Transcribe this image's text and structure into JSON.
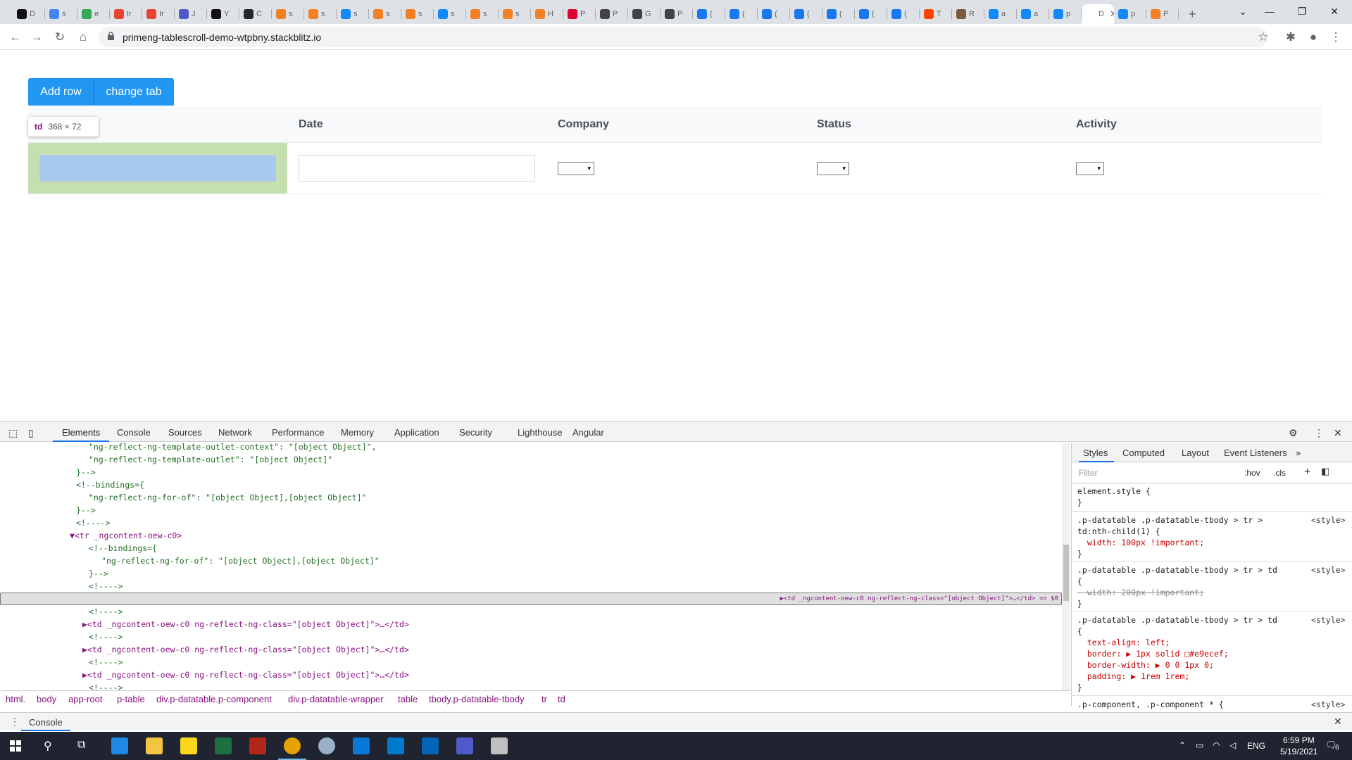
{
  "browser": {
    "tabs": [
      {
        "label": "D",
        "color": "#111111"
      },
      {
        "label": "s",
        "color": "#4285f4"
      },
      {
        "label": "e",
        "color": "#34a853"
      },
      {
        "label": "Ir",
        "color": "#ea4335"
      },
      {
        "label": "Ir",
        "color": "#ea4335"
      },
      {
        "label": "J",
        "color": "#5059c9"
      },
      {
        "label": "Y",
        "color": "#111111"
      },
      {
        "label": "C",
        "color": "#24292e"
      },
      {
        "label": "s",
        "color": "#f48024"
      },
      {
        "label": "s",
        "color": "#f48024"
      },
      {
        "label": "s",
        "color": "#1389fd"
      },
      {
        "label": "s",
        "color": "#f48024"
      },
      {
        "label": "s",
        "color": "#f48024"
      },
      {
        "label": "s",
        "color": "#1389fd"
      },
      {
        "label": "s",
        "color": "#f48024"
      },
      {
        "label": "s",
        "color": "#f48024"
      },
      {
        "label": "H",
        "color": "#f48024"
      },
      {
        "label": "P",
        "color": "#dd0031"
      },
      {
        "label": "P",
        "color": "#444444"
      },
      {
        "label": "G",
        "color": "#444444"
      },
      {
        "label": "P",
        "color": "#444444"
      },
      {
        "label": "(",
        "color": "#1877f2"
      },
      {
        "label": "(",
        "color": "#1877f2"
      },
      {
        "label": "(",
        "color": "#1877f2"
      },
      {
        "label": "(",
        "color": "#1877f2"
      },
      {
        "label": "(",
        "color": "#1877f2"
      },
      {
        "label": "(",
        "color": "#1877f2"
      },
      {
        "label": "(",
        "color": "#1877f2"
      },
      {
        "label": "T",
        "color": "#ff4500"
      },
      {
        "label": "R",
        "color": "#7a5c3b"
      },
      {
        "label": "a",
        "color": "#1389fd"
      },
      {
        "label": "a",
        "color": "#1389fd"
      },
      {
        "label": "p",
        "color": "#1389fd"
      },
      {
        "label": "D",
        "color": "#ffffff",
        "active": true
      },
      {
        "label": "p",
        "color": "#1389fd"
      },
      {
        "label": "P",
        "color": "#f48024"
      }
    ],
    "new_tab": "+",
    "url": "primeng-tablescroll-demo-wtpbny.stackblitz.io"
  },
  "page": {
    "buttons": {
      "add_row": "Add row",
      "change_tab": "change tab"
    },
    "columns": [
      "Date",
      "Company",
      "Status",
      "Activity"
    ],
    "select_arrow": "▾",
    "tooltip": {
      "tag": "td",
      "size": "368 × 72"
    },
    "colors": {
      "primary": "#2196f3",
      "highlight": "#c6dfb0",
      "input_highlight": "#a8c9ee"
    }
  },
  "devtools": {
    "tabs": [
      "Elements",
      "Console",
      "Sources",
      "Network",
      "Performance",
      "Memory",
      "Application",
      "Security",
      "Lighthouse",
      "Angular"
    ],
    "active_tab": "Elements",
    "dom_lines": [
      {
        "indent": 14,
        "text": "\"ng-reflect-ng-template-outlet-context\": \"[object Object]\",",
        "cls": "c-cm"
      },
      {
        "indent": 14,
        "text": "\"ng-reflect-ng-template-outlet\": \"[object Object]\"",
        "cls": "c-cm"
      },
      {
        "indent": 12,
        "text": "}-->",
        "cls": "c-cm"
      },
      {
        "indent": 12,
        "text": "<!--bindings={",
        "cls": "c-cm"
      },
      {
        "indent": 14,
        "text": "\"ng-reflect-ng-for-of\": \"[object Object],[object Object]\"",
        "cls": "c-cm"
      },
      {
        "indent": 12,
        "text": "}-->",
        "cls": "c-cm"
      },
      {
        "indent": 12,
        "text": "<!---->",
        "cls": "c-cm"
      },
      {
        "indent": 11,
        "text": "▼<tr _ngcontent-oew-c0>",
        "cls": "c-tag"
      },
      {
        "indent": 14,
        "text": "<!--bindings={",
        "cls": "c-cm"
      },
      {
        "indent": 16,
        "text": "\"ng-reflect-ng-for-of\": \"[object Object],[object Object]\"",
        "cls": "c-cm"
      },
      {
        "indent": 14,
        "text": "}-->",
        "cls": "c-cm"
      },
      {
        "indent": 14,
        "text": "<!---->",
        "cls": "c-cm"
      },
      {
        "indent": 13,
        "text": "▶<td _ngcontent-oew-c0 ng-reflect-ng-class=\"[object Object]\">…</td> == $0",
        "cls": "c-tag",
        "selected": true
      },
      {
        "indent": 14,
        "text": "<!---->",
        "cls": "c-cm"
      },
      {
        "indent": 13,
        "text": "▶<td _ngcontent-oew-c0 ng-reflect-ng-class=\"[object Object]\">…</td>",
        "cls": "c-tag"
      },
      {
        "indent": 14,
        "text": "<!---->",
        "cls": "c-cm"
      },
      {
        "indent": 13,
        "text": "▶<td _ngcontent-oew-c0 ng-reflect-ng-class=\"[object Object]\">…</td>",
        "cls": "c-tag"
      },
      {
        "indent": 14,
        "text": "<!---->",
        "cls": "c-cm"
      },
      {
        "indent": 13,
        "text": "▶<td _ngcontent-oew-c0 ng-reflect-ng-class=\"[object Object]\">…</td>",
        "cls": "c-tag"
      },
      {
        "indent": 14,
        "text": "<!---->",
        "cls": "c-cm"
      }
    ],
    "breadcrumbs": [
      "html.",
      "body",
      "app-root",
      "p-table",
      "div.p-datatable.p-component",
      "div.p-datatable-wrapper",
      "table",
      "tbody.p-datatable-tbody",
      "tr",
      "td"
    ],
    "styles_tabs": [
      "Styles",
      "Computed",
      "Layout",
      "Event Listeners",
      "»"
    ],
    "filter_placeholder": "Filter",
    "hov": ":hov",
    "cls": ".cls",
    "style_lines": [
      {
        "text": "element.style {",
        "kind": "sel-r"
      },
      {
        "text": "}",
        "kind": "sel-r"
      },
      {
        "text": ".p-datatable .p-datatable-tbody > tr >",
        "kind": "sel-r",
        "src": "<style>"
      },
      {
        "text": "td:nth-child(1) {",
        "kind": "sel-r"
      },
      {
        "text": "  width: 100px !important;",
        "kind": "prop"
      },
      {
        "text": "}",
        "kind": "sel-r"
      },
      {
        "text": ".p-datatable .p-datatable-tbody > tr > td",
        "kind": "sel-r",
        "src": "<style>"
      },
      {
        "text": "{",
        "kind": "sel-r"
      },
      {
        "text": "  width: 200px !important;",
        "kind": "strike"
      },
      {
        "text": "}",
        "kind": "sel-r"
      },
      {
        "text": ".p-datatable .p-datatable-tbody > tr > td",
        "kind": "sel-r",
        "src": "<style>"
      },
      {
        "text": "{",
        "kind": "sel-r"
      },
      {
        "text": "  text-align: left;",
        "kind": "prop"
      },
      {
        "text": "  border: ▶ 1px solid □#e9ecef;",
        "kind": "prop"
      },
      {
        "text": "  border-width: ▶ 0 0 1px 0;",
        "kind": "prop"
      },
      {
        "text": "  padding: ▶ 1rem 1rem;",
        "kind": "prop"
      },
      {
        "text": "}",
        "kind": "sel-r"
      },
      {
        "text": ".p-component, .p-component * {",
        "kind": "sel-r",
        "src": "<style>"
      }
    ],
    "console_label": "Console"
  },
  "taskbar": {
    "lang": "ENG",
    "time": "6:59 PM",
    "date": "5/19/2021",
    "notifications": "6"
  }
}
